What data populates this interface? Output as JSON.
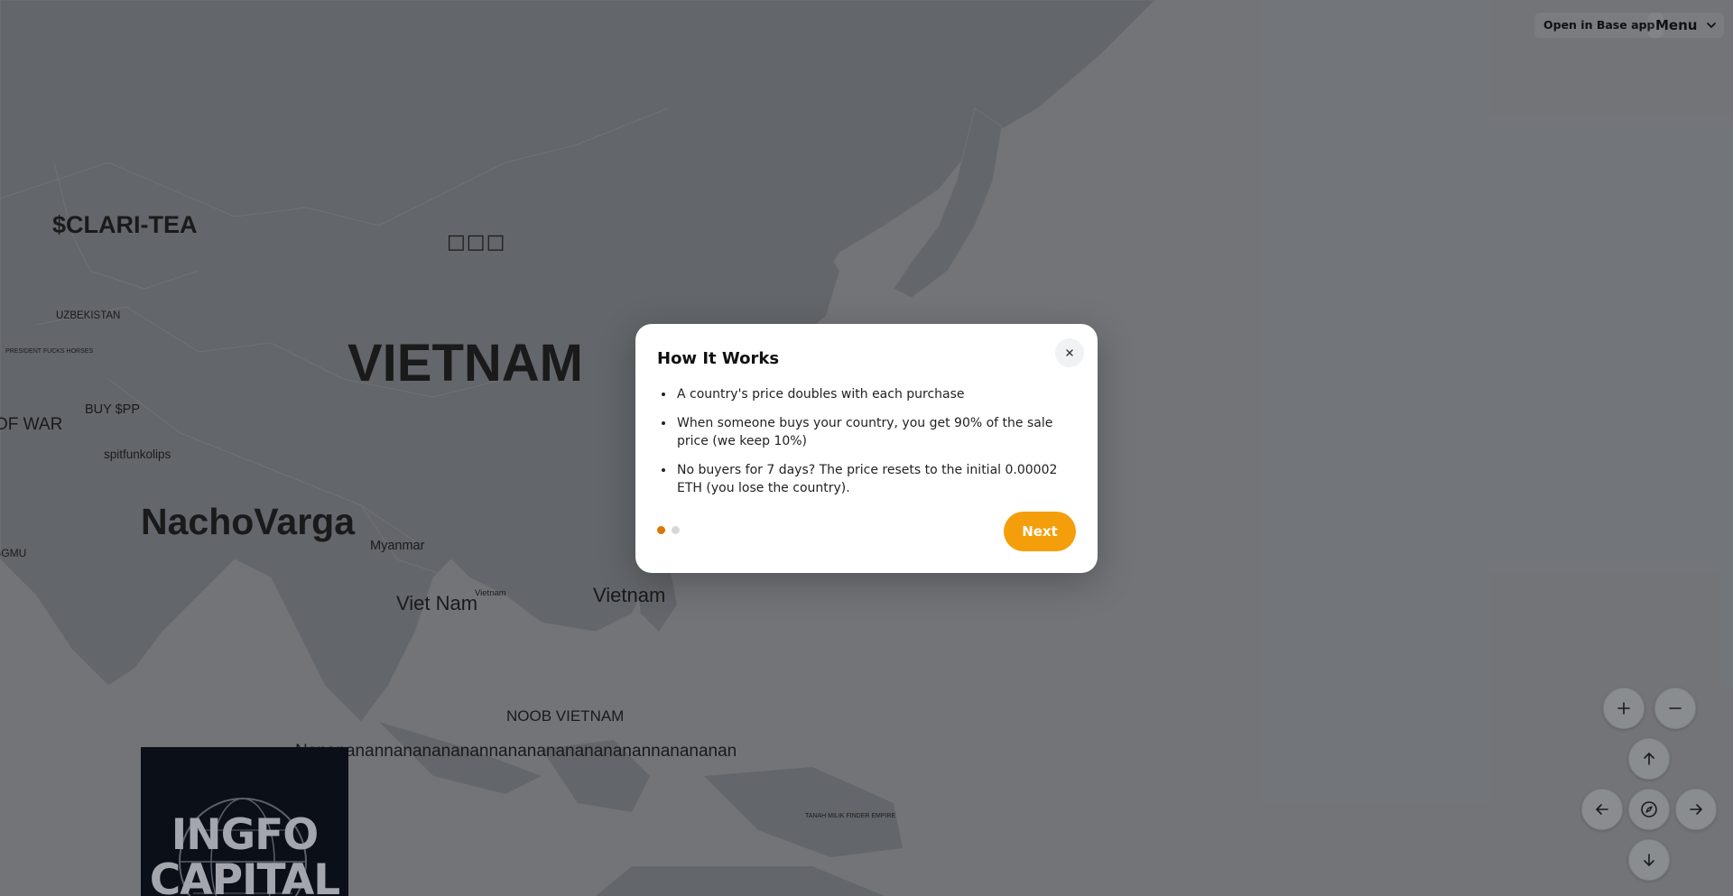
{
  "topbar": {
    "open_base_label": "Open in Base app",
    "menu_label": "Menu"
  },
  "map": {
    "labels": [
      {
        "id": "clari-tea",
        "text": "$CLARI-TEA"
      },
      {
        "id": "korean-tag",
        "text": "□□□"
      },
      {
        "id": "uzbekistan",
        "text": "UZBEKISTAN"
      },
      {
        "id": "president",
        "text": "PRESIDENT FUCKS HORSES"
      },
      {
        "id": "vietnam-big",
        "text": "VIETNAM"
      },
      {
        "id": "of-war",
        "text": "OF WAR"
      },
      {
        "id": "buy-pp",
        "text": "BUY $PP"
      },
      {
        "id": "spitfunkolips",
        "text": "spitfunkolips"
      },
      {
        "id": "nachovarga",
        "text": "NachoVarga"
      },
      {
        "id": "myanmar",
        "text": "Myanmar"
      },
      {
        "id": "ggmu",
        "text": "GGMU"
      },
      {
        "id": "viet-nam",
        "text": "Viet Nam"
      },
      {
        "id": "vietnam-small",
        "text": "Vietnam"
      },
      {
        "id": "vietnam-mid",
        "text": "Vietnam"
      },
      {
        "id": "noob-vietnam",
        "text": "NOOB VIETNAM"
      },
      {
        "id": "nanana",
        "text": "Nanananannananananannanananananananannanananan"
      },
      {
        "id": "tanah",
        "text": "TANAH MILIK FINDER EMPIRE"
      }
    ]
  },
  "promo": {
    "line1": "INGFO",
    "line2": "CAPITAL"
  },
  "modal": {
    "title": "How It Works",
    "bullets": [
      "A country's price doubles with each purchase",
      "When someone buys your country, you get 90% of the sale price (we keep 10%)",
      "No buyers for 7 days? The price resets to the initial 0.00002 ETH (you lose the country)."
    ],
    "next_label": "Next",
    "step_current": 1,
    "step_total": 2
  },
  "controls": {
    "icons": [
      "plus-icon",
      "minus-icon",
      "arrow-up-icon",
      "arrow-left-icon",
      "compass-icon",
      "arrow-right-icon",
      "arrow-down-icon"
    ]
  },
  "colors": {
    "accent": "#f59e0b",
    "active_dot": "#d97706",
    "map_land": "#9b9ea1"
  }
}
